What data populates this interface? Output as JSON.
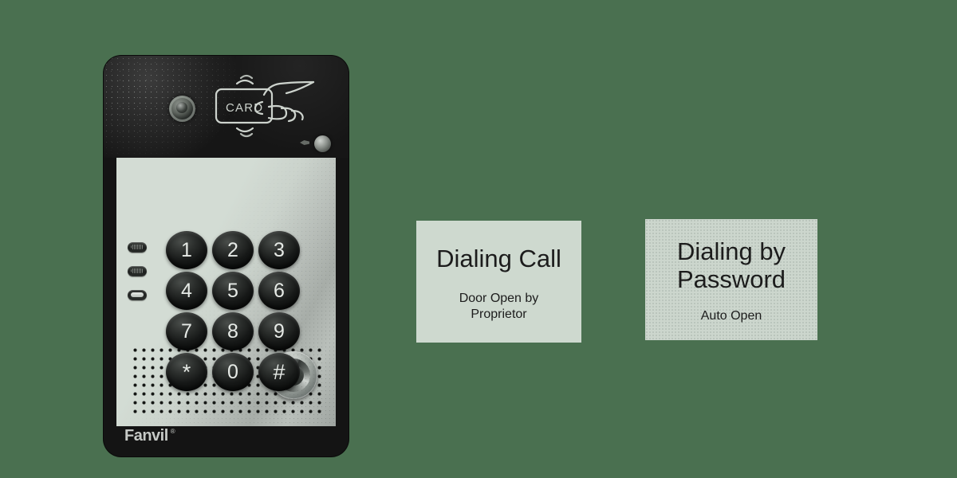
{
  "scene": {
    "background_color": "#4a7050",
    "type": "product-diagram"
  },
  "device": {
    "brand": "Fanvil",
    "trademark": "®",
    "body_color": "#141414",
    "faceplate_color": "#d3dcd4",
    "camera_icon": "camera-lens-icon",
    "card_reader": {
      "icon": "rfid-card-hand-icon",
      "label": "CARD"
    },
    "sensor_icon": "light-sensor-icon",
    "indicator_leds": [
      {
        "name": "led-1",
        "state": "off"
      },
      {
        "name": "led-2",
        "state": "off"
      },
      {
        "name": "led-3",
        "state": "on"
      }
    ],
    "keypad": {
      "keys": [
        "1",
        "2",
        "3",
        "4",
        "5",
        "6",
        "7",
        "8",
        "9",
        "*",
        "0",
        "#"
      ]
    },
    "speaker": {
      "icon": "speaker-grille-icon"
    },
    "call_button": {
      "icon": "call-button-icon"
    }
  },
  "panels": [
    {
      "id": "dialing-call",
      "title": "Dialing Call",
      "subtitle": "Door Open by\nProprietor",
      "background_color": "#ced9cf"
    },
    {
      "id": "dialing-by-password",
      "title": "Dialing by\nPassword",
      "subtitle": "Auto Open",
      "background_color": "#ccd6cd"
    }
  ]
}
